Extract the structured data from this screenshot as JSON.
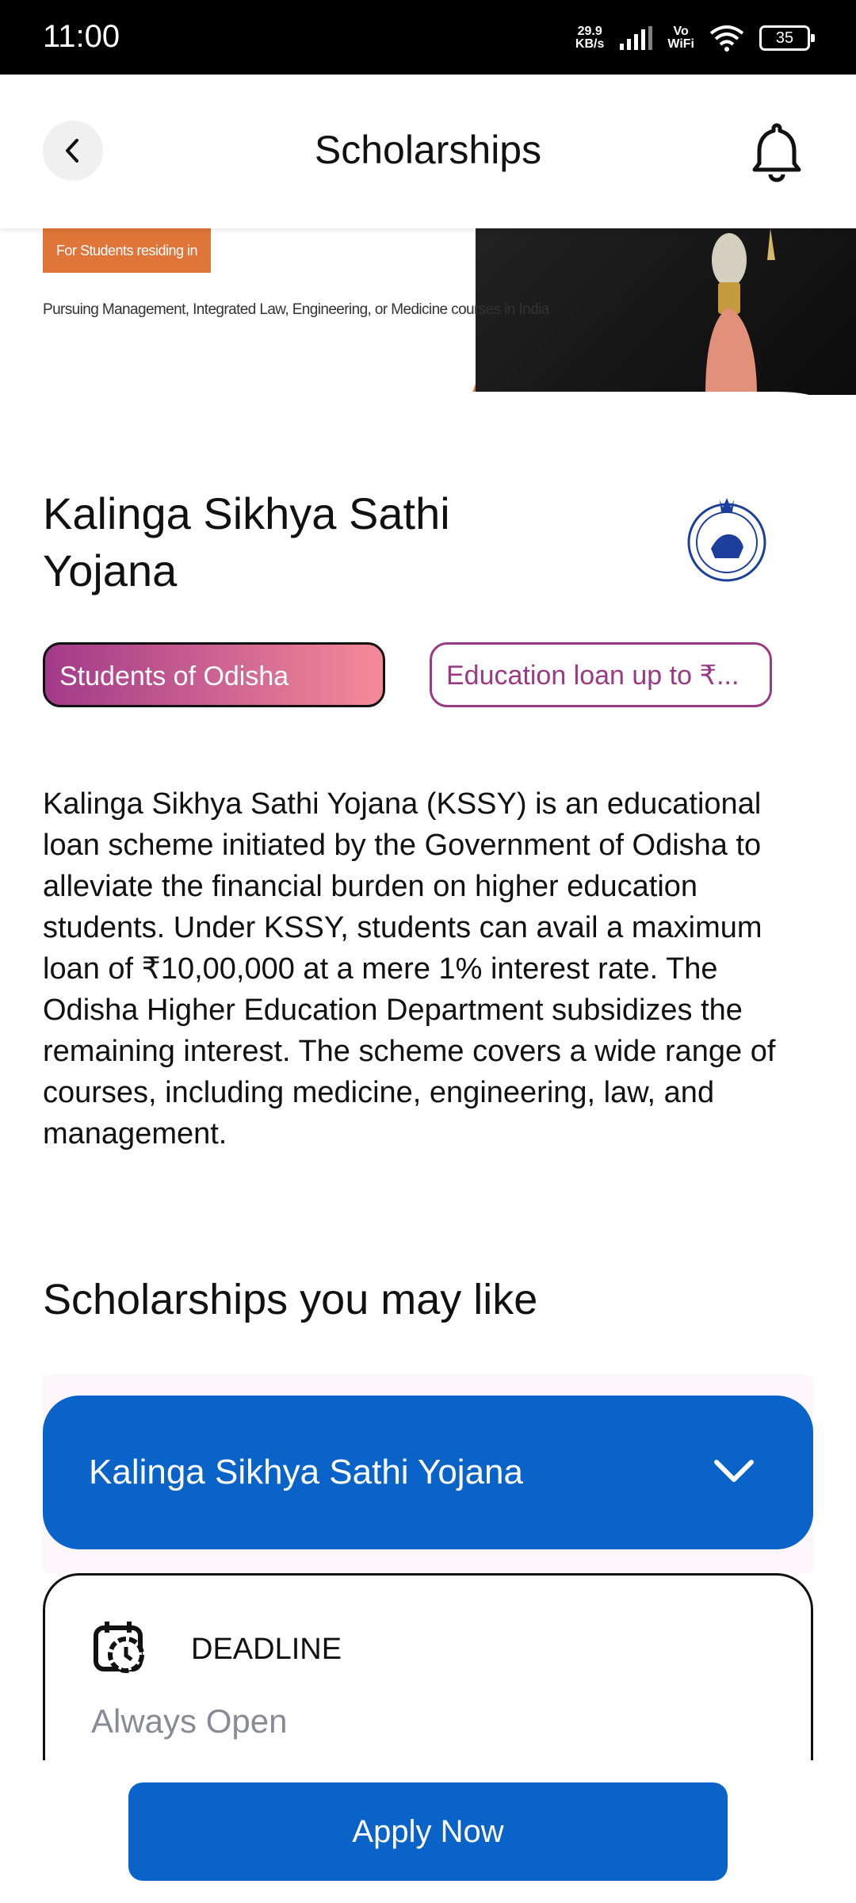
{
  "status_bar": {
    "time": "11:00",
    "net_speed_value": "29.9",
    "net_speed_unit": "KB/s",
    "volte_top": "Vo",
    "volte_bottom": "WiFi",
    "battery": "35"
  },
  "header": {
    "title": "Scholarships"
  },
  "banner": {
    "tag": "For Students residing in Odisha",
    "subtitle": "Pursuing Management, Integrated Law, Engineering, or Medicine courses in India"
  },
  "scheme": {
    "title": "Kalinga Sikhya Sathi Yojana",
    "chips": [
      "Students of Odisha",
      "Education loan up to ₹..."
    ],
    "description": "Kalinga Sikhya Sathi Yojana (KSSY) is an educational loan scheme initiated by the Government of Odisha to alleviate the financial burden on higher education students. Under KSSY, students can avail a maximum loan of ₹10,00,000 at a mere 1% interest rate. The Odisha Higher Education Department subsidizes the remaining interest. The scheme covers a wide range of courses, including medicine, engineering, law, and management."
  },
  "recommendations": {
    "section_title": "Scholarships you may like",
    "card": {
      "title": "Kalinga Sikhya Sathi Yojana",
      "deadline_label": "DEADLINE",
      "deadline_value": "Always Open"
    }
  },
  "actions": {
    "apply_label": "Apply Now"
  },
  "colors": {
    "primary": "#0a63c9",
    "chip_gradient_start": "#a23a8a",
    "chip_gradient_end": "#f48a98",
    "chip_outline": "#9b3a84",
    "banner_orange": "#e0753a"
  }
}
